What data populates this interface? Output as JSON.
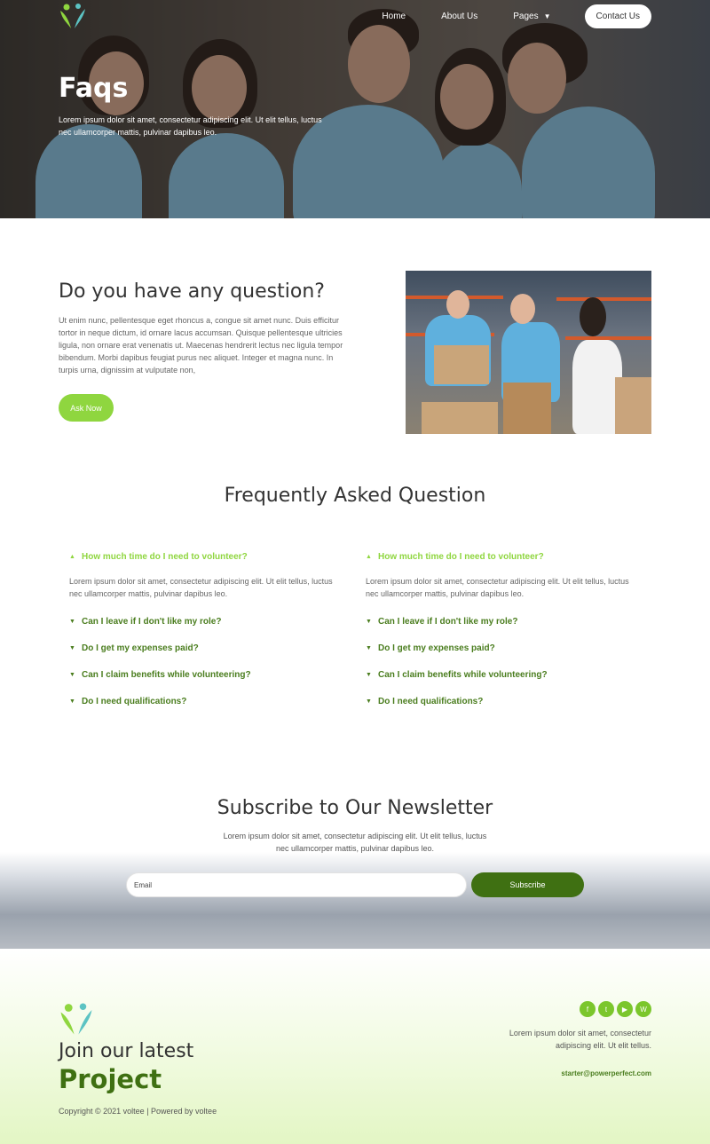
{
  "nav": {
    "home": "Home",
    "about": "About Us",
    "pages": "Pages",
    "contact": "Contact Us"
  },
  "hero": {
    "title": "Faqs",
    "text": "Lorem ipsum dolor sit amet, consectetur adipiscing elit. Ut elit tellus, luctus nec ullamcorper mattis, pulvinar dapibus leo."
  },
  "question": {
    "title": "Do you have any question?",
    "text": "Ut enim nunc, pellentesque eget rhoncus a, congue sit amet nunc. Duis efficitur tortor in neque dictum, id ornare lacus accumsan. Quisque pellentesque ultricies ligula, non ornare erat venenatis ut. Maecenas hendrerit lectus nec ligula tempor bibendum. Morbi dapibus feugiat purus nec aliquet. Integer et magna nunc. In turpis urna, dignissim at vulputate non,",
    "button": "Ask Now"
  },
  "faq": {
    "title": "Frequently Asked Question",
    "columns": [
      {
        "open_question": "How much time do I need to volunteer?",
        "answer": "Lorem ipsum dolor sit amet, consectetur adipiscing elit. Ut elit tellus, luctus nec ullamcorper mattis, pulvinar dapibus leo.",
        "items": [
          "Can I leave if I don't like my role?",
          "Do I get my expenses paid?",
          "Can I claim benefits while volunteering?",
          "Do I need qualifications?"
        ]
      },
      {
        "open_question": "How much time do I need to volunteer?",
        "answer": "Lorem ipsum dolor sit amet, consectetur adipiscing elit. Ut elit tellus, luctus nec ullamcorper mattis, pulvinar dapibus leo.",
        "items": [
          "Can I leave if I don't like my role?",
          "Do I get my expenses paid?",
          "Can I claim benefits while volunteering?",
          "Do I need qualifications?"
        ]
      }
    ]
  },
  "newsletter": {
    "title": "Subscribe to Our Newsletter",
    "text": "Lorem ipsum dolor sit amet, consectetur adipiscing elit. Ut elit tellus, luctus nec ullamcorper mattis, pulvinar dapibus leo.",
    "email_placeholder": "Email",
    "button": "Subscribe"
  },
  "footer": {
    "join": "Join our latest",
    "project": "Project",
    "copyright": "Copyright © 2021 voltee | Powered by voltee",
    "description": "Lorem ipsum dolor sit amet, consectetur adipiscing elit. Ut elit tellus.",
    "email": "starter@powerperfect.com",
    "socials": [
      "facebook-icon",
      "twitter-icon",
      "youtube-icon",
      "wordpress-icon"
    ]
  },
  "colors": {
    "accent": "#8fd63f",
    "dark_green": "#3f7012",
    "text_green": "#4a7d1e"
  }
}
